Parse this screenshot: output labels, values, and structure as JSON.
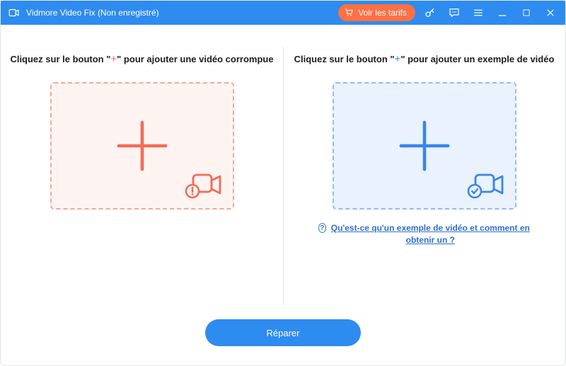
{
  "titlebar": {
    "app_title": "Vidmore Video Fix (Non enregistré)",
    "pricing_label": "Voir les tarifs"
  },
  "left_pane": {
    "heading_pre": "Cliquez sur le bouton \"",
    "heading_plus": "+",
    "heading_post": "\" pour ajouter une vidéo corrompue"
  },
  "right_pane": {
    "heading_pre": "Cliquez sur le bouton \"",
    "heading_plus": "+",
    "heading_post": "\" pour ajouter un exemple de vidéo",
    "help_link": "Qu'est-ce qu'un exemple de vidéo et comment en obtenir un ?"
  },
  "footer": {
    "repair_label": "Réparer"
  },
  "colors": {
    "accent_blue": "#2e8bf0",
    "accent_red": "#f36b55",
    "cta_orange": "#ff7043"
  }
}
